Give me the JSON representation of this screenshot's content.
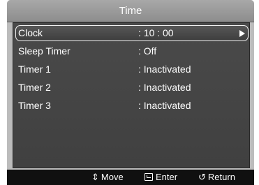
{
  "title": "Time",
  "menu": {
    "items": [
      {
        "label": "Clock",
        "value": ": 10 : 00",
        "selected": true,
        "has_submenu": true
      },
      {
        "label": "Sleep Timer",
        "value": ": Off",
        "selected": false,
        "has_submenu": false
      },
      {
        "label": "Timer 1",
        "value": ": Inactivated",
        "selected": false,
        "has_submenu": false
      },
      {
        "label": "Timer 2",
        "value": ": Inactivated",
        "selected": false,
        "has_submenu": false
      },
      {
        "label": "Timer 3",
        "value": ": Inactivated",
        "selected": false,
        "has_submenu": false
      }
    ]
  },
  "footer": {
    "move": {
      "icon": "up-down-arrow-icon",
      "label": "Move"
    },
    "enter": {
      "icon": "enter-icon",
      "label": "Enter"
    },
    "return": {
      "icon": "return-icon",
      "label": "Return"
    }
  },
  "colors": {
    "title_bar": "#9a9a9a",
    "panel": "#444444",
    "footer": "#101010",
    "frame": "#bcbcbc",
    "text": "#ffffff"
  }
}
